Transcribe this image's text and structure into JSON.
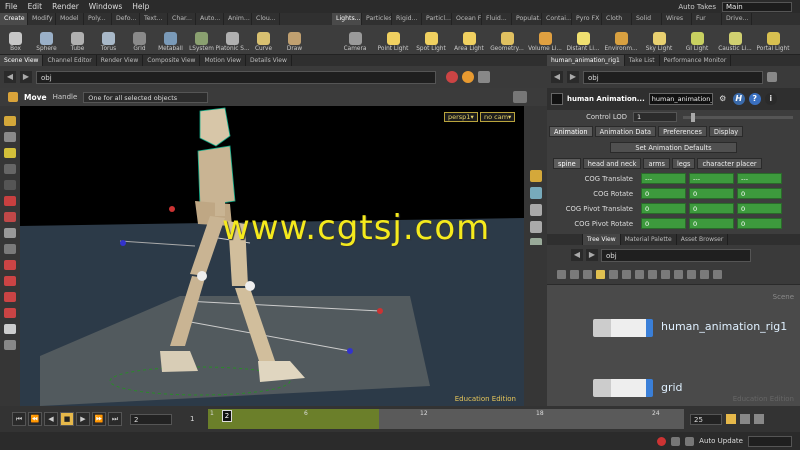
{
  "menu": [
    "File",
    "Edit",
    "Render",
    "Windows",
    "Help"
  ],
  "takes": {
    "label": "Auto Takes",
    "selected": "Main"
  },
  "shelf_tabs_left": [
    "Create",
    "Modify",
    "Model",
    "Poly...",
    "Defo...",
    "Text...",
    "Char...",
    "Auto...",
    "Anim...",
    "Clou..."
  ],
  "shelf_tabs_right": [
    "Lights...",
    "Particles",
    "Rigid...",
    "Particl...",
    "Ocean FX",
    "Fluid...",
    "Populat...",
    "Contai...",
    "Pyro FX",
    "Cloth",
    "Solid",
    "Wires",
    "Fur",
    "Drive..."
  ],
  "tools_left": [
    {
      "label": "Box",
      "color": "#c7c7c7"
    },
    {
      "label": "Sphere",
      "color": "#9ab0c8"
    },
    {
      "label": "Tube",
      "color": "#b0b0b0"
    },
    {
      "label": "Torus",
      "color": "#a8b8c8"
    },
    {
      "label": "Grid",
      "color": "#8a8a8a"
    },
    {
      "label": "Metaball",
      "color": "#7a9ab8"
    },
    {
      "label": "LSystem",
      "color": "#8aa070"
    },
    {
      "label": "Platonic S...",
      "color": "#b0b0b0"
    },
    {
      "label": "Curve",
      "color": "#d8c070"
    },
    {
      "label": "Draw",
      "color": "#c0a070"
    }
  ],
  "tools_right": [
    {
      "label": "Camera",
      "color": "#9a9a9a"
    },
    {
      "label": "Point Light",
      "color": "#f0d060"
    },
    {
      "label": "Spot Light",
      "color": "#f0d060"
    },
    {
      "label": "Area Light",
      "color": "#f0d060"
    },
    {
      "label": "Geometry...",
      "color": "#e0c060"
    },
    {
      "label": "Volume Li...",
      "color": "#e0a040"
    },
    {
      "label": "Distant Li...",
      "color": "#f0e070"
    },
    {
      "label": "Environm...",
      "color": "#d8a040"
    },
    {
      "label": "Sky Light",
      "color": "#e8d070"
    },
    {
      "label": "GI Light",
      "color": "#c8d060"
    },
    {
      "label": "Caustic Li...",
      "color": "#d0d070"
    },
    {
      "label": "Portal Light",
      "color": "#d8c050"
    }
  ],
  "pane_tabs_left": [
    "Scene View",
    "Channel Editor",
    "Render View",
    "Composite View",
    "Motion View",
    "Details View"
  ],
  "pane_tabs_right": [
    "human_animation_rig1",
    "Take List",
    "Performance Monitor"
  ],
  "viewport": {
    "path": "obj",
    "mode": "Move",
    "handle": "Handle",
    "selection_mode": "One for all selected objects",
    "camera": "persp1▾",
    "cam_menu": "no cam▾",
    "edition": "Education Edition",
    "watermark": "www.cgtsj.com"
  },
  "params": {
    "path": "obj",
    "node_type": "human Animation...",
    "node_name": "human_animation_rig1",
    "control_lod_label": "Control LOD",
    "control_lod_value": "1",
    "tabs": [
      "Animation",
      "Animation Data",
      "Preferences",
      "Display"
    ],
    "set_defaults": "Set Animation Defaults",
    "subtabs": [
      "spine",
      "head and neck",
      "arms",
      "legs",
      "character placer"
    ],
    "rows": [
      {
        "label": "COG Translate",
        "values": [
          "---",
          "---",
          "---"
        ]
      },
      {
        "label": "COG Rotate",
        "values": [
          "0",
          "0",
          "0"
        ]
      },
      {
        "label": "COG Pivot Translate",
        "values": [
          "0",
          "0",
          "0"
        ]
      },
      {
        "label": "COG Pivot Rotate",
        "values": [
          "0",
          "0",
          "0"
        ]
      }
    ]
  },
  "tree": {
    "tabs": [
      "Tree View",
      "Material Palette",
      "Asset Browser"
    ],
    "path": "obj",
    "scene_label": "Scene",
    "edition": "Education Edition",
    "nodes": [
      {
        "name": "human_animation_rig1"
      },
      {
        "name": "grid"
      }
    ]
  },
  "timeline": {
    "start": "1",
    "current": "2",
    "end": "25",
    "ticks": [
      "6",
      "12",
      "18",
      "24"
    ],
    "progress": 0.36
  },
  "status": {
    "auto_update": "Auto Update"
  }
}
